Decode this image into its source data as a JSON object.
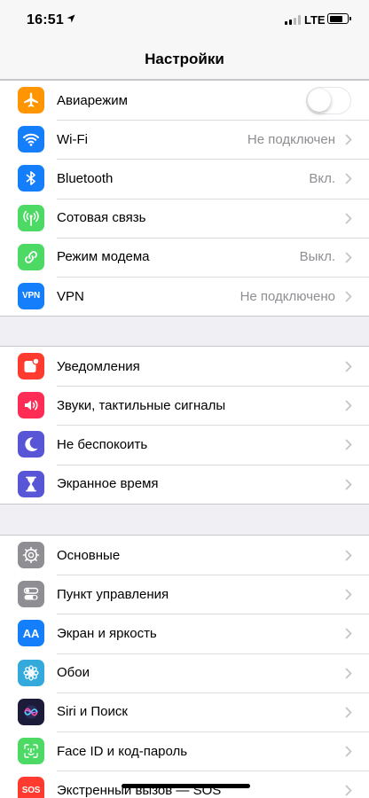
{
  "status_bar": {
    "time": "16:51",
    "network": "LTE",
    "signal_bars_active": 2,
    "signal_bars_total": 4,
    "battery_level": 0.75
  },
  "nav": {
    "title": "Настройки"
  },
  "groups": [
    {
      "rows": [
        {
          "label": "Авиарежим",
          "value": "",
          "icon": "airplane-icon",
          "color": "#ff9500",
          "toggle": true,
          "toggle_on": false
        },
        {
          "label": "Wi-Fi",
          "value": "Не подключен",
          "icon": "wifi-icon",
          "color": "#147efb"
        },
        {
          "label": "Bluetooth",
          "value": "Вкл.",
          "icon": "bluetooth-icon",
          "color": "#147efb"
        },
        {
          "label": "Сотовая связь",
          "value": "",
          "icon": "antenna-icon",
          "color": "#4cd964"
        },
        {
          "label": "Режим модема",
          "value": "Выкл.",
          "icon": "link-icon",
          "color": "#4cd964"
        },
        {
          "label": "VPN",
          "value": "Не подключено",
          "icon": "vpn-icon",
          "color": "#147efb",
          "icon_text": "VPN"
        }
      ]
    },
    {
      "rows": [
        {
          "label": "Уведомления",
          "value": "",
          "icon": "notifications-icon",
          "color": "#ff3b30"
        },
        {
          "label": "Звуки, тактильные сигналы",
          "value": "",
          "icon": "speaker-icon",
          "color": "#ff2d55"
        },
        {
          "label": "Не беспокоить",
          "value": "",
          "icon": "moon-icon",
          "color": "#5856d6"
        },
        {
          "label": "Экранное время",
          "value": "",
          "icon": "hourglass-icon",
          "color": "#5856d6"
        }
      ]
    },
    {
      "rows": [
        {
          "label": "Основные",
          "value": "",
          "icon": "gear-icon",
          "color": "#8e8e93"
        },
        {
          "label": "Пункт управления",
          "value": "",
          "icon": "switches-icon",
          "color": "#8e8e93"
        },
        {
          "label": "Экран и яркость",
          "value": "",
          "icon": "text-size-icon",
          "color": "#147efb",
          "icon_text": "AA"
        },
        {
          "label": "Обои",
          "value": "",
          "icon": "flower-icon",
          "color": "#34aadc"
        },
        {
          "label": "Siri и Поиск",
          "value": "",
          "icon": "siri-icon",
          "color": "#1c1c3a"
        },
        {
          "label": "Face ID и код-пароль",
          "value": "",
          "icon": "face-id-icon",
          "color": "#4cd964"
        },
        {
          "label": "Экстренный вызов — SOS",
          "value": "",
          "icon": "sos-icon",
          "color": "#ff3b30",
          "icon_text": "SOS"
        }
      ]
    }
  ]
}
